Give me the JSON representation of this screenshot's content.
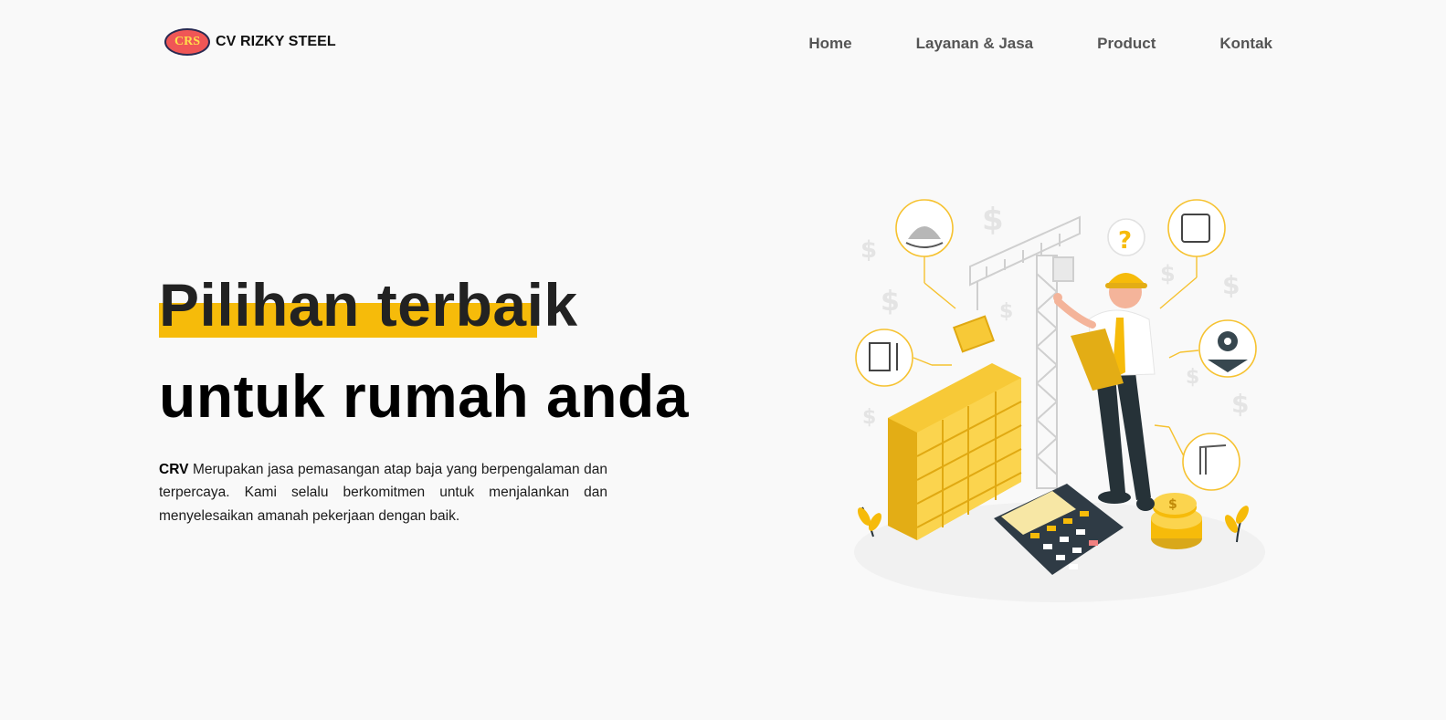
{
  "brand": {
    "logo_text": "CRS",
    "name": "CV RIZKY STEEL"
  },
  "nav": {
    "items": [
      {
        "label": "Home"
      },
      {
        "label": "Layanan & Jasa"
      },
      {
        "label": "Product"
      },
      {
        "label": "Kontak"
      }
    ]
  },
  "hero": {
    "title_line1": "Pilihan terbaik",
    "title_line2": "untuk rumah anda",
    "desc_bold": "CRV",
    "desc_text": " Merupakan jasa pemasangan atap baja yang berpengalaman dan terpercaya. Kami selalu berkomitmen untuk menjalankan dan menyelesaikan amanah pekerjaan dengan baik."
  },
  "illustration": {
    "question_mark": "?",
    "coin_symbol": "$"
  },
  "colors": {
    "accent": "#f6bb0a",
    "logo_bg": "#f05656",
    "logo_text": "#ffe04a",
    "background": "#f9f9f9"
  }
}
